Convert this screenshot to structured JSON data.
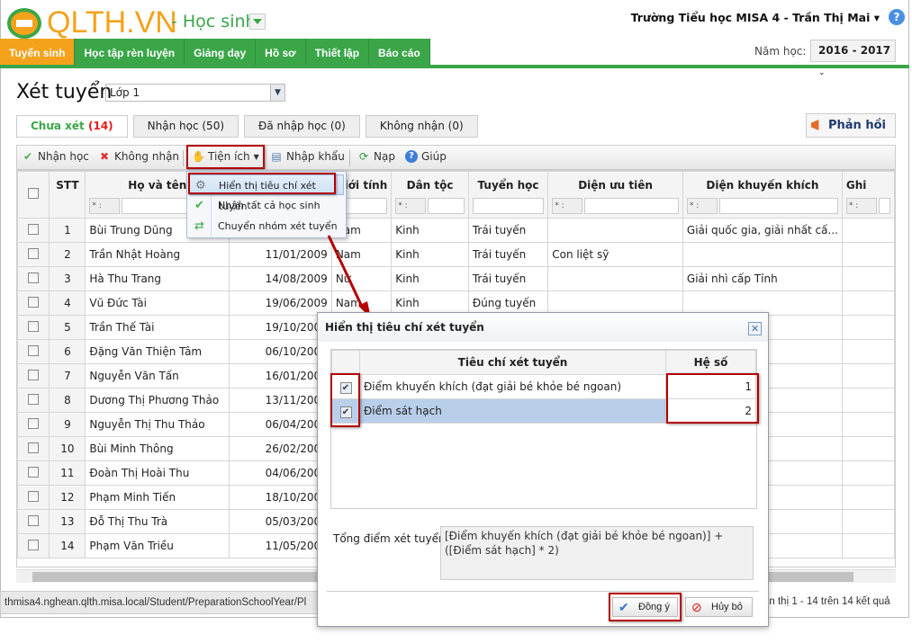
{
  "header": {
    "logo": "QLTH.VN",
    "module": "- Học sinh",
    "user": "Trường Tiểu học MISA 4 - Trần Thị Mai",
    "help_icon": "?",
    "year_label": "Năm học:",
    "year": "2016 - 2017"
  },
  "nav": [
    "Tuyển sinh",
    "Học tập rèn luyện",
    "Giảng dạy",
    "Hồ sơ",
    "Thiết lập",
    "Báo cáo"
  ],
  "page": {
    "title": "Xét tuyển",
    "class": "Lớp 1",
    "feedback": "Phản hồi"
  },
  "tabs": [
    {
      "label": "Chưa xét",
      "count": "(14)"
    },
    {
      "label": "Nhận học (50)"
    },
    {
      "label": "Đã nhập học (0)"
    },
    {
      "label": "Không nhận (0)"
    }
  ],
  "toolbar": {
    "accept": "Nhận học",
    "reject": "Không nhận",
    "utilities": "Tiện ích",
    "import": "Nhập khẩu",
    "reload": "Nạp",
    "help": "Giúp"
  },
  "menu": [
    "Hiển thị tiêu chí xét tuyển",
    "Nhận tất cả học sinh",
    "Chuyển nhóm xét tuyển"
  ],
  "columns": [
    "STT",
    "Họ và tên",
    "",
    "Giới tính",
    "Dân tộc",
    "Tuyển học",
    "Diện ưu tiên",
    "Diện khuyến khích",
    "Ghi"
  ],
  "filter_op": "* :",
  "rows": [
    [
      "1",
      "Bùi Trung Dũng",
      "",
      "Nam",
      "Kinh",
      "Trái tuyến",
      "",
      "Giải quốc gia, giải nhất cấ..."
    ],
    [
      "2",
      "Trần Nhật Hoàng",
      "11/01/2009",
      "Nam",
      "Kinh",
      "Trái tuyến",
      "Con liệt sỹ",
      ""
    ],
    [
      "3",
      "Hà Thu Trang",
      "14/08/2009",
      "Nữ",
      "Kinh",
      "Trái tuyến",
      "",
      "Giải nhì cấp Tỉnh"
    ],
    [
      "4",
      "Vũ Đức Tài",
      "19/06/2009",
      "Nam",
      "Kinh",
      "Đúng tuyến",
      "",
      ""
    ],
    [
      "5",
      "Trần Thế Tài",
      "19/10/2009",
      "",
      "",
      "",
      "",
      ""
    ],
    [
      "6",
      "Đặng Văn Thiện Tâm",
      "06/10/2009",
      "",
      "",
      "",
      "",
      ""
    ],
    [
      "7",
      "Nguyễn Văn Tấn",
      "16/01/2009",
      "",
      "",
      "",
      "",
      ""
    ],
    [
      "8",
      "Dương Thị Phương Thảo",
      "13/11/2009",
      "",
      "",
      "",
      "",
      ""
    ],
    [
      "9",
      "Nguyễn Thị Thu Thảo",
      "06/04/2009",
      "",
      "",
      "",
      "",
      ""
    ],
    [
      "10",
      "Bùi Minh Thông",
      "26/02/2009",
      "",
      "",
      "",
      "",
      ""
    ],
    [
      "11",
      "Đoàn Thị Hoài Thu",
      "04/06/2009",
      "",
      "",
      "",
      "",
      ""
    ],
    [
      "12",
      "Phạm Minh Tiến",
      "18/10/2009",
      "",
      "",
      "",
      "",
      ""
    ],
    [
      "13",
      "Đỗ Thị Thu Trà",
      "05/03/2009",
      "",
      "",
      "",
      "",
      ""
    ],
    [
      "14",
      "Phạm Văn Triều",
      "11/05/2009",
      "",
      "",
      "",
      "",
      ""
    ]
  ],
  "status_url": "thmisa4.nghean.qlth.misa.local/Student/PreparationSchoolYear/Pl",
  "pager_info": "ển thị 1 - 14 trên 14 kết quả",
  "dialog": {
    "title": "Hiển thị tiêu chí xét tuyển",
    "col_criteria": "Tiêu chí xét tuyển",
    "col_coef": "Hệ số",
    "criteria": [
      {
        "name": "Điểm khuyến khích (đạt giải bé khỏe bé ngoan)",
        "coef": "1",
        "checked": true
      },
      {
        "name": "Điểm sát hạch",
        "coef": "2",
        "checked": true
      }
    ],
    "formula_label": "Tổng điểm xét tuyển",
    "formula": "[Điểm khuyến khích (đạt giải bé khỏe bé ngoan)] + ([Điểm sát hạch] * 2)",
    "ok": "Đồng ý",
    "cancel": "Hủy bỏ"
  },
  "colors": {
    "green": "#3aa648",
    "orange": "#f4a21b",
    "highlight": "#b30000"
  }
}
